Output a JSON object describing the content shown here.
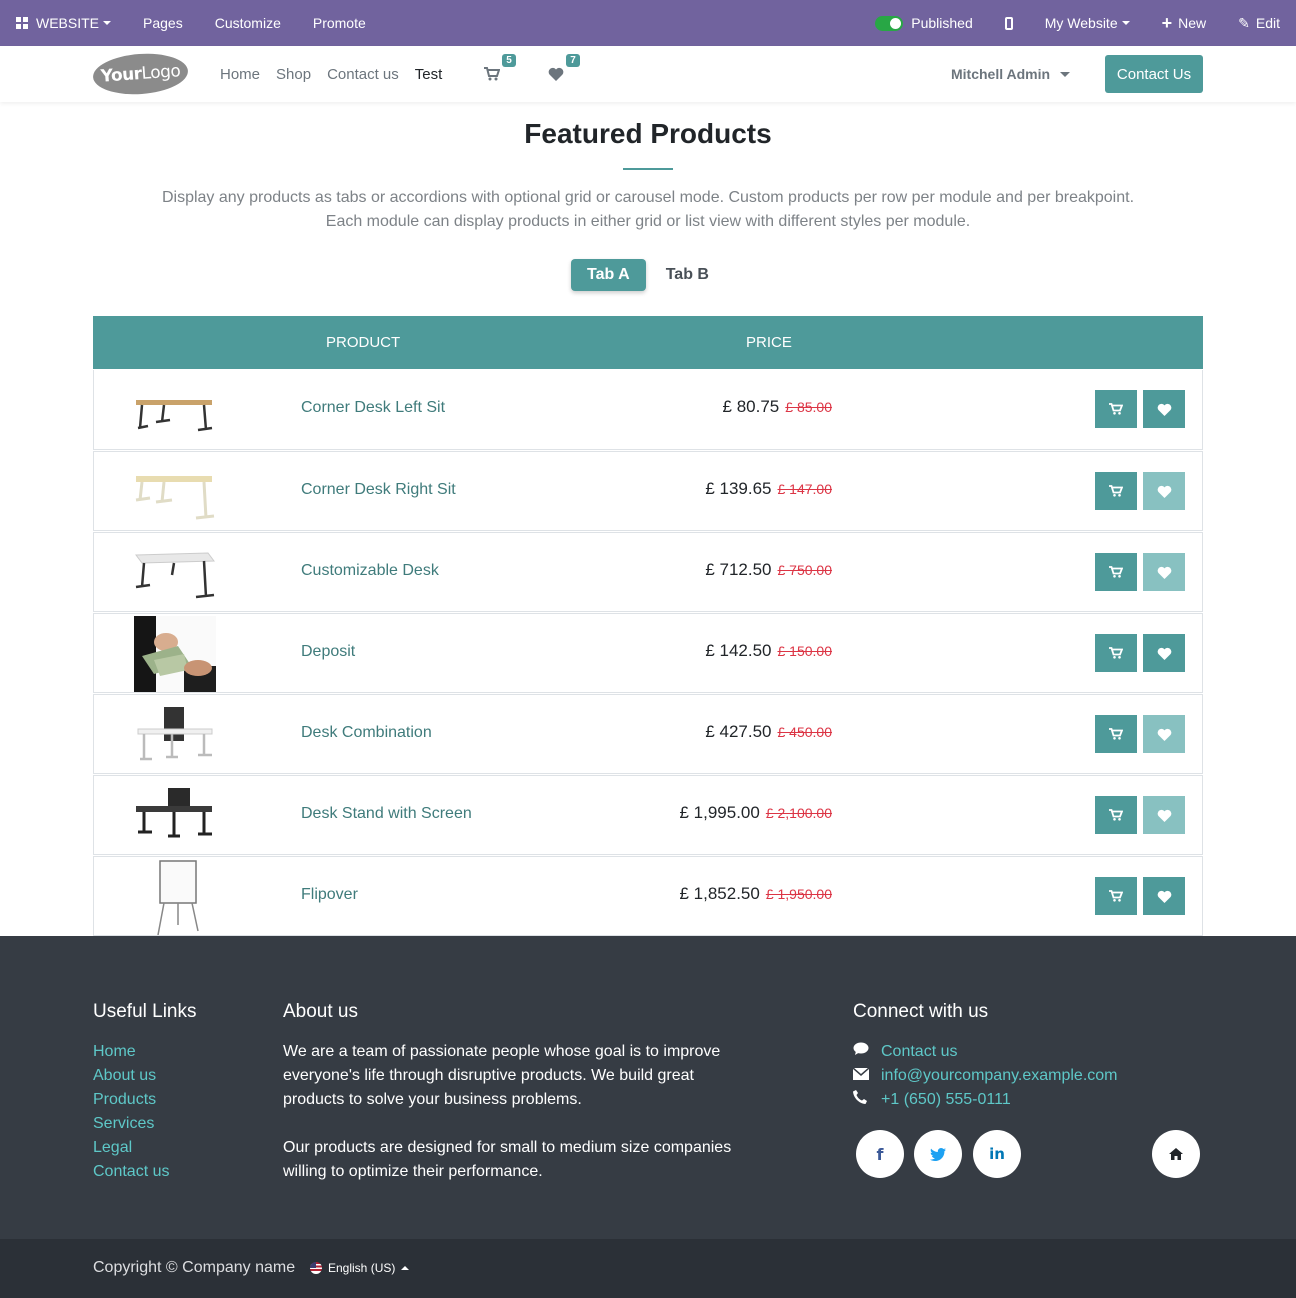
{
  "admin_bar": {
    "app_label": "WEBSITE",
    "pages": "Pages",
    "customize": "Customize",
    "promote": "Promote",
    "published": "Published",
    "my_website": "My Website",
    "new": "New",
    "edit": "Edit",
    "bg_color": "#71639e"
  },
  "header": {
    "logo_text_bold": "Your",
    "logo_text": "Logo",
    "nav": [
      "Home",
      "Shop",
      "Contact us",
      "Test"
    ],
    "cart_count": "5",
    "wishlist_count": "7",
    "user": "Mitchell Admin",
    "contact_button": "Contact Us",
    "accent_color": "#4e9a9a"
  },
  "section": {
    "title": "Featured Products",
    "description_line1": "Display any products as tabs or accordions with optional grid or carousel mode. Custom products per row per module and per breakpoint.",
    "description_line2": "Each module can display products in either grid or list view with different styles per module.",
    "tabs": [
      "Tab A",
      "Tab B"
    ],
    "active_tab": "Tab A"
  },
  "table": {
    "columns": [
      "PRODUCT",
      "PRICE"
    ],
    "rows": [
      {
        "name": "Corner Desk Left Sit",
        "price": "£ 80.75",
        "old_price": "£ 85.00",
        "thumb": "desk-wood",
        "wish_active": true
      },
      {
        "name": "Corner Desk Right Sit",
        "price": "£ 139.65",
        "old_price": "£ 147.00",
        "thumb": "desk-light",
        "wish_active": false
      },
      {
        "name": "Customizable Desk",
        "price": "£ 712.50",
        "old_price": "£ 750.00",
        "thumb": "desk-white",
        "wish_active": false
      },
      {
        "name": "Deposit",
        "price": "£ 142.50",
        "old_price": "£ 150.00",
        "thumb": "money",
        "wish_active": true
      },
      {
        "name": "Desk Combination",
        "price": "£ 427.50",
        "old_price": "£ 450.00",
        "thumb": "desk-combo",
        "wish_active": false
      },
      {
        "name": "Desk Stand with Screen",
        "price": "£ 1,995.00",
        "old_price": "£ 2,100.00",
        "thumb": "desk-screen",
        "wish_active": false
      },
      {
        "name": "Flipover",
        "price": "£ 1,852.50",
        "old_price": "£ 1,950.00",
        "thumb": "flipchart",
        "wish_active": true
      }
    ]
  },
  "footer": {
    "useful_links_title": "Useful Links",
    "useful_links": [
      "Home",
      "About us",
      "Products",
      "Services",
      "Legal",
      "Contact us"
    ],
    "about_title": "About us",
    "about_p1": "We are a team of passionate people whose goal is to improve everyone's life through disruptive products. We build great products to solve your business problems.",
    "about_p2": "Our products are designed for small to medium size companies willing to optimize their performance.",
    "connect_title": "Connect with us",
    "contact_link": "Contact us",
    "email": "info@yourcompany.example.com",
    "phone": "+1 (650) 555-0111",
    "social": [
      "facebook-icon",
      "twitter-icon",
      "linkedin-icon",
      "home-icon"
    ],
    "copyright": "Copyright © Company name",
    "language": "English (US)",
    "bg_color": "#363c44",
    "link_color": "#5ec8c8"
  }
}
